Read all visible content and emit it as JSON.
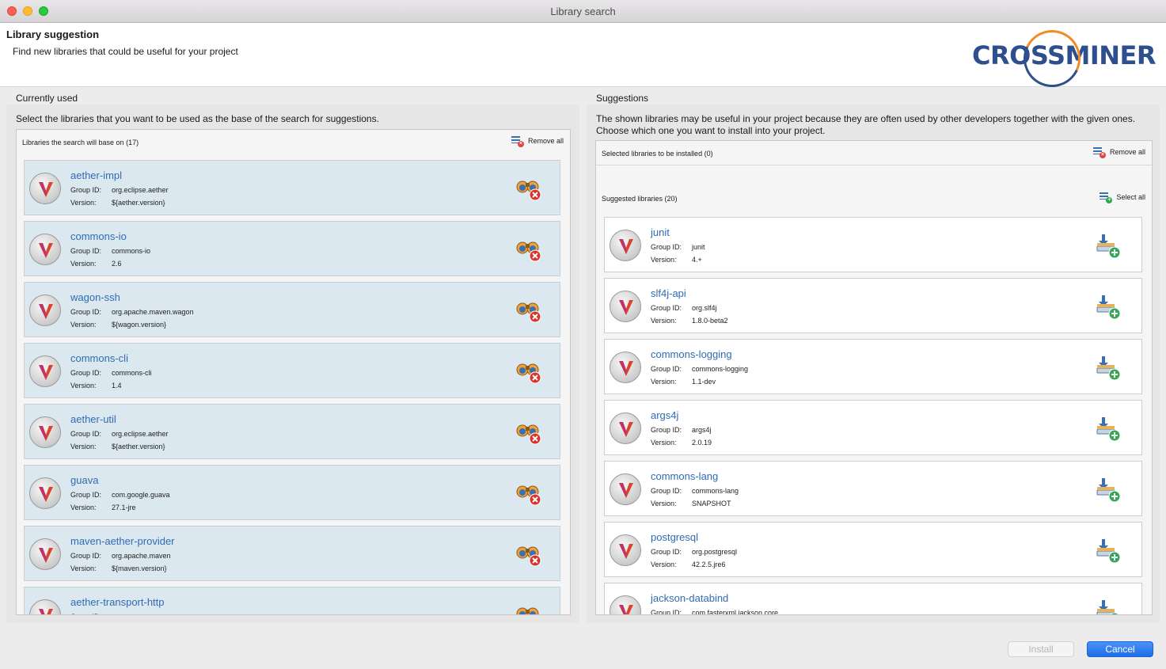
{
  "window": {
    "title": "Library search"
  },
  "header": {
    "title": "Library suggestion",
    "subtitle": "Find new libraries that could be useful for your project",
    "logo_text": "CROSSMINER"
  },
  "used": {
    "section_label": "Currently used",
    "description": "Select the libraries that you want to be used as the base of the search for suggestions.",
    "list_label": "Libraries the search will base on (17)",
    "remove_all_label": "Remove all",
    "group_label": "Group ID:",
    "version_label": "Version:",
    "items": [
      {
        "name": "aether-impl",
        "group": "org.eclipse.aether",
        "version": "${aether.version}"
      },
      {
        "name": "commons-io",
        "group": "commons-io",
        "version": "2.6"
      },
      {
        "name": "wagon-ssh",
        "group": "org.apache.maven.wagon",
        "version": "${wagon.version}"
      },
      {
        "name": "commons-cli",
        "group": "commons-cli",
        "version": "1.4"
      },
      {
        "name": "aether-util",
        "group": "org.eclipse.aether",
        "version": "${aether.version}"
      },
      {
        "name": "guava",
        "group": "com.google.guava",
        "version": "27.1-jre"
      },
      {
        "name": "maven-aether-provider",
        "group": "org.apache.maven",
        "version": "${maven.version}"
      },
      {
        "name": "aether-transport-http",
        "group": "",
        "version": ""
      }
    ]
  },
  "suggestions": {
    "section_label": "Suggestions",
    "description_line1": "The shown libraries may be useful in your project because they are often used by other developers together with the given ones.",
    "description_line2": "Choose which one you want to install into your project.",
    "selected_label": "Selected libraries to be installed (0)",
    "remove_all_label": "Remove all",
    "suggested_label": "Suggested libraries (20)",
    "select_all_label": "Select all",
    "group_label": "Group ID:",
    "version_label": "Version:",
    "items": [
      {
        "name": "junit",
        "group": "junit",
        "version": "4.+"
      },
      {
        "name": "slf4j-api",
        "group": "org.slf4j",
        "version": "1.8.0-beta2"
      },
      {
        "name": "commons-logging",
        "group": "commons-logging",
        "version": "1.1-dev"
      },
      {
        "name": "args4j",
        "group": "args4j",
        "version": "2.0.19"
      },
      {
        "name": "commons-lang",
        "group": "commons-lang",
        "version": "SNAPSHOT"
      },
      {
        "name": "postgresql",
        "group": "org.postgresql",
        "version": "42.2.5.jre6"
      },
      {
        "name": "jackson-databind",
        "group": "com.fasterxml.jackson.core",
        "version": ""
      }
    ]
  },
  "buttons": {
    "install": "Install",
    "cancel": "Cancel"
  },
  "colors": {
    "accent": "#2f6bb4",
    "used_card": "#dce8f0",
    "cancel_button": "#1c6ee8",
    "logo_orange": "#f08c24",
    "logo_blue": "#2d4f8e"
  }
}
